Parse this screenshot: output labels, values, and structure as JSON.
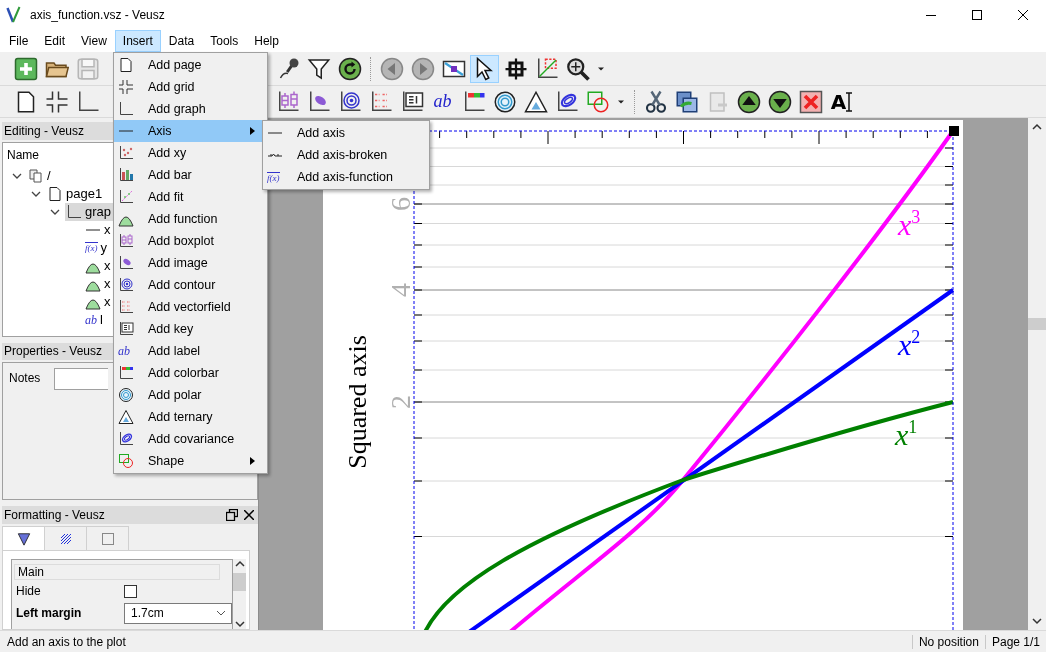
{
  "window": {
    "title": "axis_function.vsz - Veusz"
  },
  "menu_bar": [
    {
      "label": "File",
      "selected": false
    },
    {
      "label": "Edit",
      "selected": false
    },
    {
      "label": "View",
      "selected": false
    },
    {
      "label": "Insert",
      "selected": true
    },
    {
      "label": "Data",
      "selected": false
    },
    {
      "label": "Tools",
      "selected": false
    },
    {
      "label": "Help",
      "selected": false
    }
  ],
  "toolbar_1": {
    "groups": [
      [
        {
          "kind": "new",
          "selected": false,
          "disabled": false
        },
        {
          "kind": "open",
          "selected": false,
          "disabled": false
        },
        {
          "kind": "save",
          "selected": false,
          "disabled": true
        }
      ],
      [
        {
          "kind": "microphone",
          "selected": false,
          "disabled": false
        },
        {
          "kind": "filter",
          "selected": false,
          "disabled": false
        },
        {
          "kind": "reload",
          "selected": false,
          "disabled": false
        }
      ],
      [
        {
          "kind": "previous",
          "selected": false,
          "disabled": false
        },
        {
          "kind": "next",
          "selected": false,
          "disabled": false
        },
        {
          "kind": "select-region",
          "selected": false,
          "disabled": false
        },
        {
          "kind": "pointer",
          "selected": true,
          "disabled": false
        },
        {
          "kind": "crosshair",
          "selected": false,
          "disabled": false
        },
        {
          "kind": "zoom-graph",
          "selected": false,
          "disabled": false
        },
        {
          "kind": "zoom",
          "selected": false,
          "disabled": false
        },
        {
          "kind": "caret",
          "selected": false,
          "disabled": false
        }
      ]
    ]
  },
  "toolbar_2": {
    "groups": [
      [
        {
          "kind": "page",
          "disabled": false
        },
        {
          "kind": "grid",
          "disabled": false
        },
        {
          "kind": "graph",
          "disabled": false
        }
      ],
      [
        {
          "kind": "boxplot",
          "disabled": false
        },
        {
          "kind": "image",
          "disabled": false
        },
        {
          "kind": "contour",
          "disabled": false
        },
        {
          "kind": "vectorfield",
          "disabled": false
        },
        {
          "kind": "key",
          "disabled": false
        },
        {
          "kind": "label",
          "icon_text": "ab",
          "disabled": false
        },
        {
          "kind": "colorbar",
          "disabled": false
        },
        {
          "kind": "polar",
          "disabled": false
        },
        {
          "kind": "ternary",
          "disabled": false
        },
        {
          "kind": "covariance",
          "disabled": false
        },
        {
          "kind": "shape",
          "disabled": false
        },
        {
          "kind": "caret",
          "disabled": false
        }
      ],
      [
        {
          "kind": "cut",
          "disabled": false
        },
        {
          "kind": "copy",
          "disabled": false
        },
        {
          "kind": "paste",
          "disabled": true
        },
        {
          "kind": "up",
          "disabled": false
        },
        {
          "kind": "down",
          "disabled": false
        },
        {
          "kind": "delete",
          "disabled": false
        },
        {
          "kind": "rename",
          "icon_text": "A",
          "disabled": false
        }
      ]
    ]
  },
  "insert_menu": {
    "items": [
      {
        "label": "Add page",
        "kind": "page",
        "submenu": false,
        "selected": false
      },
      {
        "label": "Add grid",
        "kind": "grid",
        "submenu": false,
        "selected": false
      },
      {
        "label": "Add graph",
        "kind": "graph",
        "submenu": false,
        "selected": false
      },
      {
        "label": "Axis",
        "kind": "axis",
        "submenu": true,
        "selected": true
      },
      {
        "label": "Add xy",
        "kind": "xy",
        "submenu": false,
        "selected": false
      },
      {
        "label": "Add bar",
        "kind": "bar",
        "submenu": false,
        "selected": false
      },
      {
        "label": "Add fit",
        "kind": "fit",
        "submenu": false,
        "selected": false
      },
      {
        "label": "Add function",
        "kind": "function",
        "submenu": false,
        "selected": false
      },
      {
        "label": "Add boxplot",
        "kind": "boxplot",
        "submenu": false,
        "selected": false
      },
      {
        "label": "Add image",
        "kind": "image",
        "submenu": false,
        "selected": false
      },
      {
        "label": "Add contour",
        "kind": "contour",
        "submenu": false,
        "selected": false
      },
      {
        "label": "Add vectorfield",
        "kind": "vectorfield",
        "submenu": false,
        "selected": false
      },
      {
        "label": "Add key",
        "kind": "key",
        "submenu": false,
        "selected": false
      },
      {
        "label": "Add label",
        "kind": "label",
        "icon_text": "ab",
        "submenu": false,
        "selected": false
      },
      {
        "label": "Add colorbar",
        "kind": "colorbar",
        "submenu": false,
        "selected": false
      },
      {
        "label": "Add polar",
        "kind": "polar",
        "submenu": false,
        "selected": false
      },
      {
        "label": "Add ternary",
        "kind": "ternary",
        "submenu": false,
        "selected": false
      },
      {
        "label": "Add covariance",
        "kind": "covariance",
        "submenu": false,
        "selected": false
      },
      {
        "label": "Shape",
        "kind": "shape",
        "submenu": true,
        "selected": false
      }
    ]
  },
  "axis_submenu": {
    "items": [
      {
        "label": "Add axis",
        "kind": "axis"
      },
      {
        "label": "Add axis-broken",
        "kind": "axis-broken"
      },
      {
        "label": "Add axis-function",
        "kind": "axis-function",
        "icon_text": "f(x)"
      }
    ]
  },
  "editing_dock": {
    "title": "Editing - Veusz",
    "header": "Name",
    "tree": [
      {
        "label": "/",
        "kind": "root",
        "expanded": true,
        "selected": false,
        "children": [
          {
            "label": "page1",
            "kind": "page",
            "expanded": true,
            "selected": false,
            "children": [
              {
                "label": "grap",
                "kind": "graph",
                "expanded": true,
                "selected": true,
                "children": [
                  {
                    "label": "x",
                    "kind": "axis",
                    "selected": false
                  },
                  {
                    "label": "y",
                    "kind": "axis-function",
                    "icon_text": "f(x)",
                    "selected": false
                  },
                  {
                    "label": "x",
                    "kind": "function",
                    "selected": false
                  },
                  {
                    "label": "x",
                    "kind": "function",
                    "selected": false
                  },
                  {
                    "label": "x",
                    "kind": "function",
                    "selected": false
                  },
                  {
                    "label": "l",
                    "kind": "label",
                    "icon_text": "ab",
                    "selected": false
                  }
                ]
              }
            ]
          }
        ]
      }
    ]
  },
  "properties_dock": {
    "title": "Properties - Veusz",
    "notes_label": "Notes"
  },
  "formatting_dock": {
    "title": "Formatting - Veusz",
    "tabs": [
      {
        "kind": "main",
        "selected": true
      },
      {
        "kind": "fill",
        "selected": false
      },
      {
        "kind": "border",
        "selected": false
      }
    ],
    "section": "Main",
    "rows": [
      {
        "kind": "checkbox",
        "label": "Hide",
        "checked": false,
        "bold": false
      },
      {
        "kind": "select",
        "label": "Left margin",
        "value": "1.7cm",
        "bold": true
      }
    ]
  },
  "plot": {
    "y_axis_title": "Squared axis",
    "y_tick_labels": [
      "6",
      "4",
      "2"
    ],
    "curves": [
      {
        "label": "x$^{3}$",
        "kind": "convex",
        "color": "#ff00ff"
      },
      {
        "label": "x$^{2}$",
        "kind": "straight",
        "color": "#0000ff"
      },
      {
        "label": "x$^{1}$",
        "kind": "concave",
        "color": "#008000"
      }
    ]
  },
  "status_bar": {
    "message": "Add an axis to the plot",
    "position": "No position",
    "page": "Page 1/1"
  }
}
